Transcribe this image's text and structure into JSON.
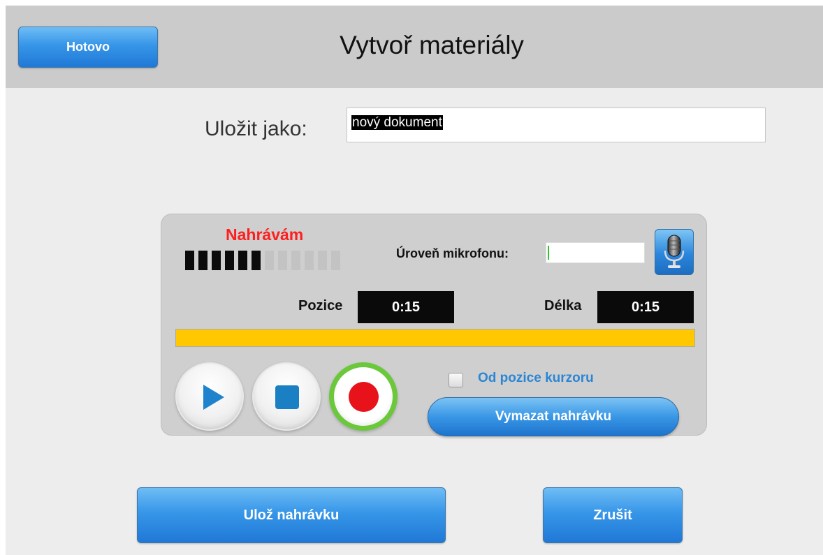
{
  "header": {
    "done_label": "Hotovo",
    "title": "Vytvoř materiály"
  },
  "save_as": {
    "label": "Uložit jako:",
    "value": "nový dokument"
  },
  "recorder": {
    "status": "Nahrávám",
    "level_meter": {
      "segments_total": 12,
      "segments_on": 6
    },
    "mic_level_label": "Úroveň mikrofonu:",
    "mic_level_fraction": 0.01,
    "mic_icon": "microphone-icon",
    "position_label": "Pozice",
    "position_value": "0:15",
    "length_label": "Délka",
    "length_value": "0:15",
    "progress_fraction": 1.0,
    "progress_color": "#ffc800",
    "controls": {
      "play_icon": "play-icon",
      "stop_icon": "stop-icon",
      "record_icon": "record-icon",
      "record_active_color": "#6ac83a"
    },
    "from_cursor_label": "Od pozice kurzoru",
    "from_cursor_checked": false,
    "clear_label": "Vymazat nahrávku"
  },
  "footer": {
    "save_label": "Ulož nahrávku",
    "cancel_label": "Zrušit"
  },
  "colors": {
    "accent_blue": "#3796e8",
    "recording_red": "#ff1e1e",
    "header_gray": "#cbcbcb"
  }
}
